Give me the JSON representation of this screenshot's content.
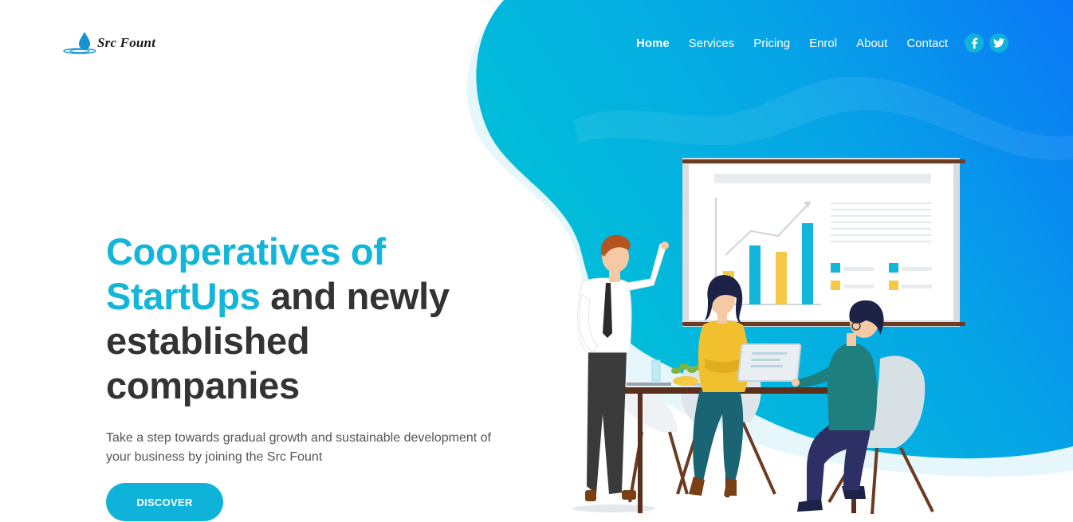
{
  "brand": {
    "name": "Src Fount",
    "logo_icon": "water-drop-icon"
  },
  "nav": {
    "items": [
      {
        "label": "Home",
        "active": true
      },
      {
        "label": "Services",
        "active": false
      },
      {
        "label": "Pricing",
        "active": false
      },
      {
        "label": "Enrol",
        "active": false
      },
      {
        "label": "About",
        "active": false
      },
      {
        "label": "Contact",
        "active": false
      }
    ]
  },
  "social": [
    {
      "icon": "facebook-icon",
      "glyph": "f"
    },
    {
      "icon": "twitter-icon",
      "glyph": "t"
    }
  ],
  "hero": {
    "title_accent_1": "Cooperatives of",
    "title_accent_2": "StartUps",
    "title_rest_1": " and newly",
    "title_rest_2": "established",
    "title_rest_3": "companies",
    "subtitle": "Take a step towards gradual growth and sustainable development of your business by joining the Src Fount",
    "cta_label": "DISCOVER"
  },
  "colors": {
    "accent": "#12b6d8",
    "blob_start": "#00c0d6",
    "blob_end": "#0a7af5",
    "heading": "#333333",
    "body_text": "#555555"
  }
}
